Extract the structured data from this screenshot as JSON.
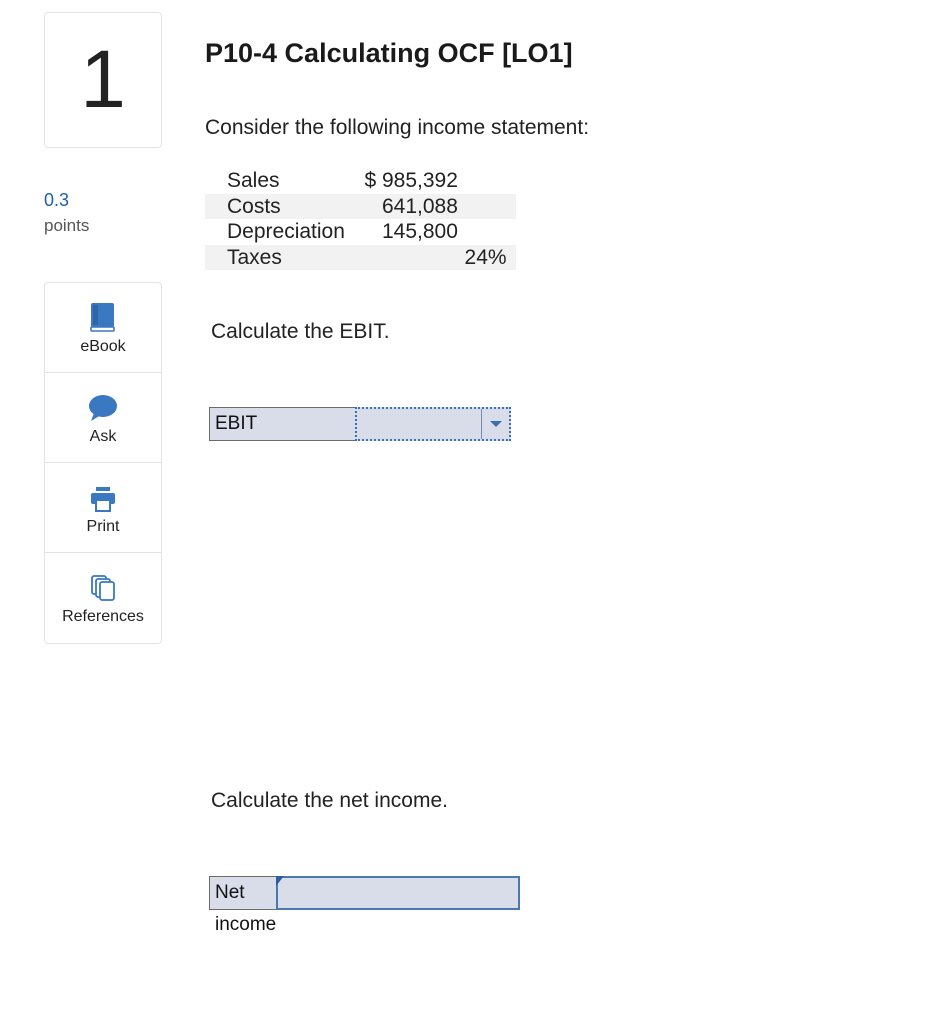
{
  "question": {
    "number": "1",
    "points_value": "0.3",
    "points_label": "points",
    "title": "P10-4 Calculating OCF [LO1]",
    "intro": "Consider the following income statement:"
  },
  "tools": [
    {
      "label": "eBook",
      "icon": "book-icon"
    },
    {
      "label": "Ask",
      "icon": "chat-bubble-icon"
    },
    {
      "label": "Print",
      "icon": "printer-icon"
    },
    {
      "label": "References",
      "icon": "copies-icon"
    }
  ],
  "statement": {
    "rows": [
      {
        "label": "Sales",
        "prefix": "$",
        "value": "985,392",
        "suffix": ""
      },
      {
        "label": "Costs",
        "prefix": "",
        "value": "641,088",
        "suffix": ""
      },
      {
        "label": "Depreciation",
        "prefix": "",
        "value": "145,800",
        "suffix": ""
      },
      {
        "label": "Taxes",
        "prefix": "",
        "value": "24",
        "suffix": "%"
      }
    ]
  },
  "part1": {
    "prompt": "Calculate the EBIT.",
    "field_label": "EBIT",
    "selected_value": ""
  },
  "part2": {
    "prompt": "Calculate the net income.",
    "field_label": "Net income",
    "value": ""
  },
  "colors": {
    "accent": "#1f5fa8",
    "icon_blue": "#3a78c2",
    "field_bg": "#d9dde9"
  }
}
